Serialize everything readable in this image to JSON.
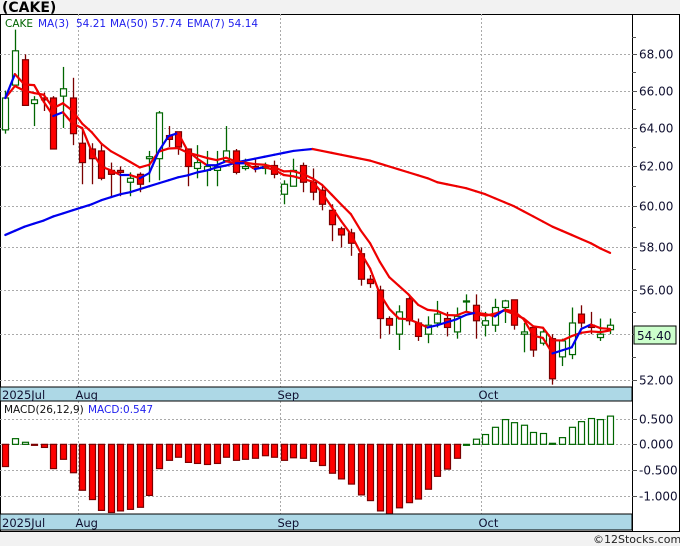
{
  "title": "(CAKE)",
  "footer": "©12Stocks.com",
  "legend": {
    "ticker": "CAKE",
    "ma3_label": "MA(3)",
    "ma3_value": "54.21",
    "ma50_label": "MA(50)",
    "ma50_value": "57.74",
    "ema7_label": "EMA(7)",
    "ema7_value": "54.14"
  },
  "last_price_label": "54.40",
  "macd_legend": {
    "label": "MACD(26,12,9)",
    "value": "MACD:0.547"
  },
  "colors": {
    "up": "#006600",
    "down_fill": "#ff0000",
    "down_edge": "#7a0000",
    "rising_line": "#0000ee",
    "falling_line": "#ee0000",
    "date_strip": "#add8e6",
    "last_price_box": "#ccffcc"
  },
  "chart_data": [
    {
      "type": "candlestick",
      "ticker": "CAKE",
      "y_scale": "log",
      "ylim": [
        51.7,
        70.3
      ],
      "grid": true,
      "y_ticks": [
        52,
        54,
        56,
        58,
        60,
        62,
        64,
        66,
        68
      ],
      "y_tick_labels": [
        "52.00",
        "",
        "56.00",
        "58.00",
        "60.00",
        "62.00",
        "64.00",
        "66.00",
        "68.00"
      ],
      "x_ticks": [
        {
          "label": "2025Jul",
          "index": 0
        },
        {
          "label": "Aug",
          "index": 8
        },
        {
          "label": "Sep",
          "index": 29
        },
        {
          "label": "Oct",
          "index": 50
        }
      ],
      "ohlc": [
        [
          63.9,
          66.0,
          63.7,
          65.6
        ],
        [
          66.3,
          69.4,
          66.3,
          68.2
        ],
        [
          67.7,
          68.0,
          65.2,
          65.2
        ],
        [
          65.3,
          65.7,
          64.1,
          65.5
        ],
        [
          65.6,
          65.9,
          64.9,
          65.5
        ],
        [
          65.6,
          65.7,
          62.9,
          62.9
        ],
        [
          65.7,
          67.3,
          64.0,
          66.1
        ],
        [
          65.6,
          66.7,
          63.1,
          63.7
        ],
        [
          63.2,
          63.9,
          61.1,
          62.2
        ],
        [
          62.9,
          63.2,
          61.1,
          62.4
        ],
        [
          62.8,
          63.2,
          61.3,
          61.4
        ],
        [
          61.8,
          62.2,
          60.5,
          61.6
        ],
        [
          61.8,
          62.0,
          60.5,
          61.7
        ],
        [
          61.2,
          61.7,
          60.5,
          61.4
        ],
        [
          61.6,
          61.7,
          60.7,
          61.1
        ],
        [
          62.4,
          62.8,
          61.2,
          62.5
        ],
        [
          62.4,
          64.9,
          61.3,
          64.8
        ],
        [
          63.6,
          64.1,
          63.0,
          63.4
        ],
        [
          63.8,
          63.8,
          62.6,
          63.0
        ],
        [
          62.9,
          62.9,
          61.0,
          62.0
        ],
        [
          61.9,
          63.1,
          61.4,
          62.2
        ],
        [
          61.8,
          62.8,
          61.0,
          62.0
        ],
        [
          61.8,
          62.8,
          61.0,
          62.0
        ],
        [
          62.3,
          64.1,
          62.2,
          62.8
        ],
        [
          62.8,
          62.9,
          61.6,
          61.7
        ],
        [
          61.9,
          62.4,
          61.8,
          62.0
        ],
        [
          62.0,
          62.4,
          61.7,
          61.9
        ],
        [
          61.9,
          62.2,
          61.6,
          62.0
        ],
        [
          62.05,
          62.3,
          61.4,
          61.6
        ],
        [
          60.6,
          61.3,
          60.1,
          61.1
        ],
        [
          61.0,
          62.4,
          61.0,
          61.8
        ],
        [
          62.05,
          62.2,
          60.7,
          61.2
        ],
        [
          61.2,
          61.9,
          60.3,
          60.7
        ],
        [
          60.8,
          61.0,
          59.8,
          60.1
        ],
        [
          59.8,
          60.1,
          58.3,
          59.1
        ],
        [
          58.9,
          59.0,
          58.0,
          58.6
        ],
        [
          58.7,
          58.9,
          57.6,
          58.2
        ],
        [
          57.7,
          58.0,
          56.2,
          56.5
        ],
        [
          56.5,
          56.7,
          56.1,
          56.3
        ],
        [
          56.0,
          56.2,
          53.8,
          54.7
        ],
        [
          54.7,
          54.8,
          54.0,
          54.4
        ],
        [
          54.0,
          55.3,
          53.3,
          55.0
        ],
        [
          55.6,
          55.8,
          54.4,
          54.6
        ],
        [
          54.5,
          54.7,
          53.7,
          53.9
        ],
        [
          54.0,
          54.8,
          53.6,
          54.4
        ],
        [
          54.5,
          55.5,
          54.3,
          54.9
        ],
        [
          54.7,
          55.0,
          53.9,
          54.3
        ],
        [
          54.1,
          55.2,
          53.8,
          54.8
        ],
        [
          55.45,
          55.8,
          55.0,
          55.5
        ],
        [
          55.3,
          55.8,
          53.8,
          54.6
        ],
        [
          54.4,
          55.0,
          53.9,
          54.6
        ],
        [
          54.4,
          55.6,
          54.1,
          55.2
        ],
        [
          55.2,
          55.55,
          54.5,
          55.5
        ],
        [
          55.55,
          55.55,
          54.2,
          54.4
        ],
        [
          54.0,
          54.5,
          53.2,
          54.1
        ],
        [
          54.3,
          54.3,
          53.0,
          53.3
        ],
        [
          53.6,
          54.3,
          53.5,
          54.1
        ],
        [
          53.8,
          54.0,
          51.8,
          52.05
        ],
        [
          53.0,
          53.8,
          52.6,
          53.7
        ],
        [
          53.1,
          55.2,
          52.9,
          54.5
        ],
        [
          54.9,
          55.3,
          54.3,
          54.5
        ],
        [
          54.4,
          55.0,
          54.0,
          54.3
        ],
        [
          53.85,
          54.7,
          53.7,
          54.0
        ],
        [
          54.2,
          54.7,
          54.0,
          54.4
        ]
      ],
      "ma50": [
        58.6,
        58.8,
        59.0,
        59.15,
        59.3,
        59.5,
        59.65,
        59.8,
        59.95,
        60.1,
        60.3,
        60.45,
        60.6,
        60.7,
        60.85,
        61.0,
        61.15,
        61.3,
        61.45,
        61.55,
        61.7,
        61.8,
        61.95,
        62.05,
        62.2,
        62.3,
        62.4,
        62.5,
        62.6,
        62.7,
        62.8,
        62.85,
        62.9,
        62.8,
        62.7,
        62.6,
        62.5,
        62.4,
        62.3,
        62.15,
        62.0,
        61.85,
        61.7,
        61.55,
        61.4,
        61.2,
        61.1,
        61.0,
        60.9,
        60.75,
        60.6,
        60.4,
        60.2,
        60.0,
        59.75,
        59.5,
        59.25,
        59.0,
        58.8,
        58.6,
        58.4,
        58.2,
        57.95,
        57.74
      ]
    },
    {
      "type": "bar",
      "indicator": "MACD(26,12,9)",
      "ylim": [
        -1.35,
        0.84
      ],
      "grid": true,
      "y_ticks": [
        0.5,
        0,
        -0.5,
        -1.0
      ],
      "y_tick_labels": [
        "0.500",
        "0.000",
        "-0.500",
        "-1.000"
      ],
      "x_ticks": [
        {
          "label": "2025Jul",
          "index": 0
        },
        {
          "label": "Aug",
          "index": 8
        },
        {
          "label": "Sep",
          "index": 29
        },
        {
          "label": "Oct",
          "index": 50
        }
      ],
      "values": [
        -0.43,
        0.11,
        0.04,
        -0.01,
        -0.06,
        -0.47,
        -0.29,
        -0.55,
        -0.89,
        -1.07,
        -1.28,
        -1.32,
        -1.29,
        -1.26,
        -1.22,
        -0.99,
        -0.47,
        -0.31,
        -0.25,
        -0.35,
        -0.37,
        -0.39,
        -0.37,
        -0.25,
        -0.31,
        -0.29,
        -0.27,
        -0.22,
        -0.25,
        -0.31,
        -0.26,
        -0.27,
        -0.33,
        -0.41,
        -0.56,
        -0.67,
        -0.77,
        -0.98,
        -1.09,
        -1.29,
        -1.42,
        -1.23,
        -1.13,
        -1.06,
        -0.87,
        -0.62,
        -0.48,
        -0.27,
        0.0,
        0.1,
        0.19,
        0.33,
        0.48,
        0.42,
        0.37,
        0.23,
        0.21,
        0.02,
        0.13,
        0.33,
        0.44,
        0.5,
        0.48,
        0.547
      ]
    }
  ]
}
